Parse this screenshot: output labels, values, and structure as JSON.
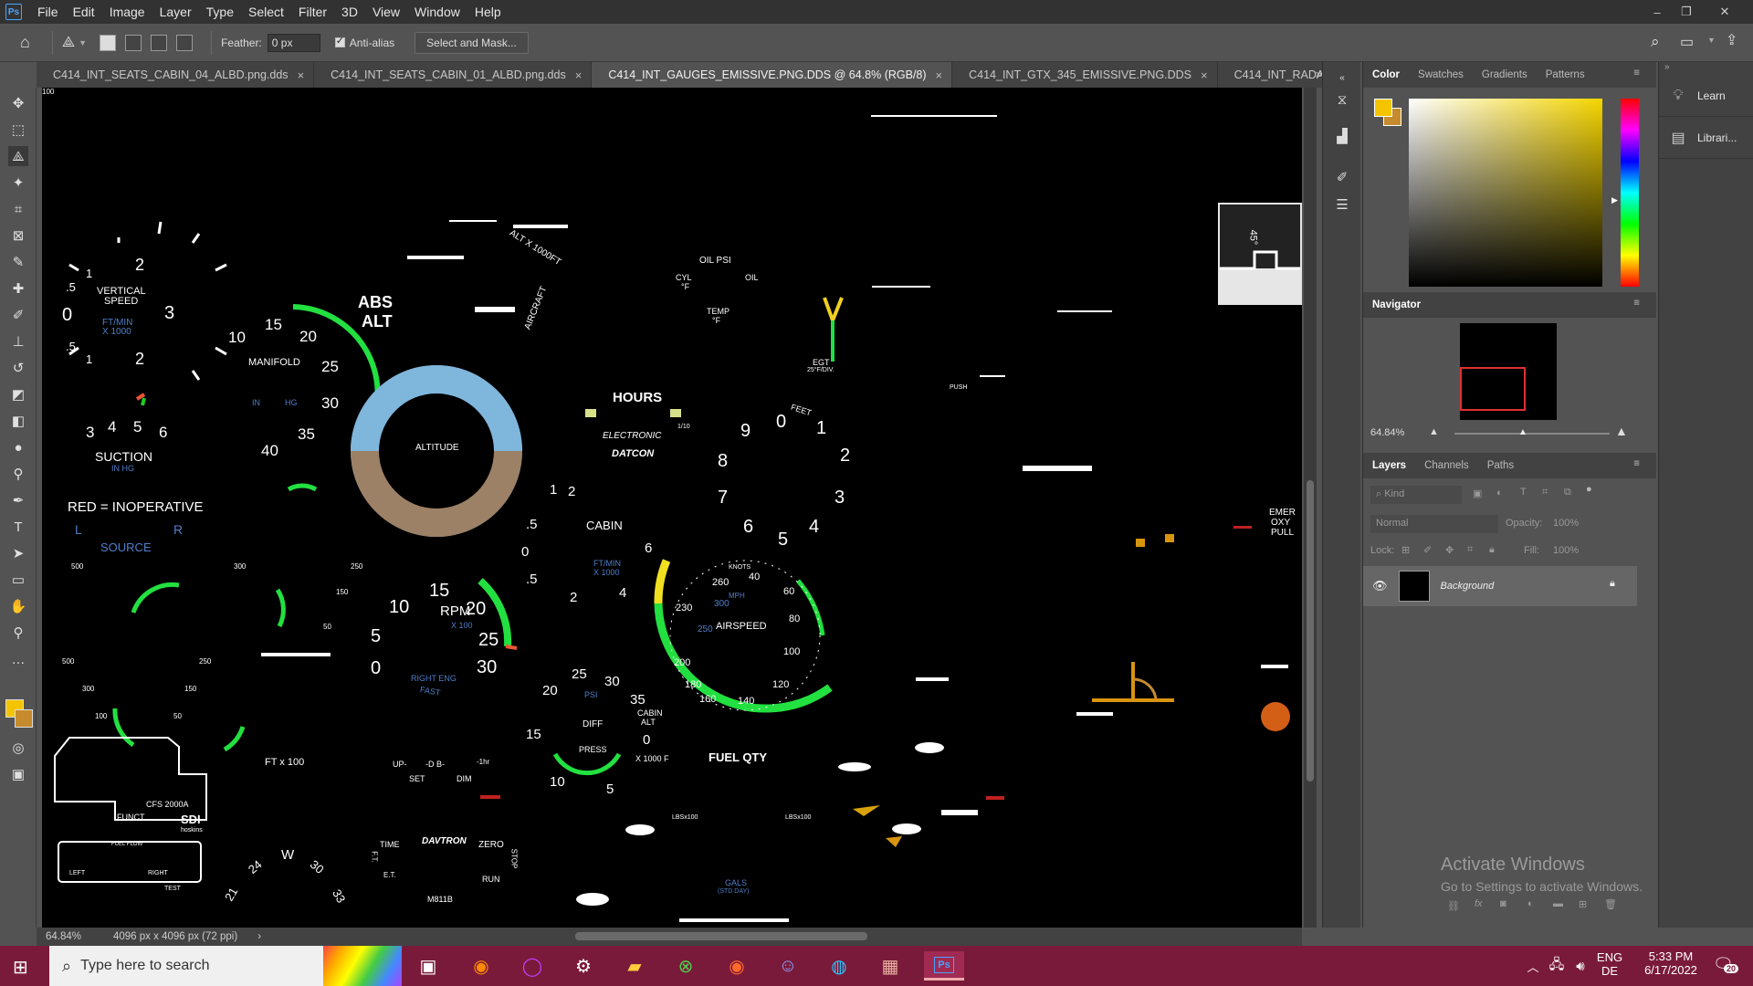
{
  "menubar": {
    "logo": "Ps",
    "items": [
      "File",
      "Edit",
      "Image",
      "Layer",
      "Type",
      "Select",
      "Filter",
      "3D",
      "View",
      "Window",
      "Help"
    ]
  },
  "options": {
    "feather_label": "Feather:",
    "feather_value": "0 px",
    "antialias_label": "Anti-alias",
    "select_mask_label": "Select and Mask..."
  },
  "tabs": [
    {
      "label": "C414_INT_SEATS_CABIN_04_ALBD.png.dds",
      "active": false
    },
    {
      "label": "C414_INT_SEATS_CABIN_01_ALBD.png.dds",
      "active": false
    },
    {
      "label": "C414_INT_GAUGES_EMISSIVE.PNG.DDS @ 64.8% (RGB/8)",
      "active": true
    },
    {
      "label": "C414_INT_GTX_345_EMISSIVE.PNG.DDS",
      "active": false
    },
    {
      "label": "C414_INT_RADAR_EMI",
      "active": false
    }
  ],
  "status": {
    "zoom": "64.84%",
    "doc_info": "4096 px x 4096 px (72 ppi)"
  },
  "color_panel": {
    "tabs": [
      "Color",
      "Swatches",
      "Gradients",
      "Patterns"
    ],
    "foreground": "#f5c400",
    "background": "#c58b2c"
  },
  "navigator": {
    "title": "Navigator",
    "zoom": "64.84%"
  },
  "layers_panel": {
    "tabs": [
      "Layers",
      "Channels",
      "Paths"
    ],
    "kind_placeholder": "Kind",
    "blend_mode": "Normal",
    "opacity_label": "Opacity:",
    "opacity_value": "100%",
    "lock_label": "Lock:",
    "fill_label": "Fill:",
    "fill_value": "100%",
    "layer_name": "Background"
  },
  "learn_panel": {
    "items": [
      "Learn",
      "Librari..."
    ]
  },
  "canvas_text": {
    "vs_vertical": "VERTICAL",
    "vs_speed": "SPEED",
    "vs_ftmin": "FT/MIN",
    "vs_x1000": "X 1000",
    "vs_2a": "2",
    "vs_1a": "1",
    "vs_5a": ".5",
    "vs_0": "0",
    "vs_3": "3",
    "vs_5b": ".5",
    "vs_1b": "1",
    "vs_2b": "2",
    "suction": "SUCTION",
    "suction_unit": "IN HG",
    "suction_3": "3",
    "suction_4": "4",
    "suction_5": "5",
    "suction_6": "6",
    "red_inop": "RED = INOPERATIVE",
    "source_l": "L",
    "source_r": "R",
    "source": "SOURCE",
    "manifold": "MANIFOLD",
    "manifold_in": "IN",
    "manifold_hg": "HG",
    "mf_10": "10",
    "mf_15": "15",
    "mf_20": "20",
    "mf_25": "25",
    "mf_30": "30",
    "mf_35": "35",
    "mf_40": "40",
    "abs": "ABS",
    "alt": "ALT",
    "aircraft": "AIRCRAFT",
    "alt_x1000": "ALT X 1000FT",
    "oil_psi": "OIL  PSI",
    "cyl": "CYL",
    "cyl_f": "°F",
    "oil": "OIL",
    "temp": "TEMP",
    "temp_f": "°F",
    "egt": "EGT",
    "egt_div": "25°F/DIV.",
    "hours": "HOURS",
    "electronic": "ELECTRONIC",
    "tenths": "1/10",
    "datcon": "DATCON",
    "altitude": "ALTITUDE",
    "feet": "FEET",
    "alt_9": "9",
    "alt_0": "0",
    "alt_1": "1",
    "alt_2": "2",
    "alt_3": "3",
    "alt_4": "4",
    "alt_5": "5",
    "alt_6": "6",
    "alt_7": "7",
    "alt_8": "8",
    "cabin": "CABIN",
    "cabin_ftmin": "FT/MIN",
    "cabin_x1000": "X 1000",
    "cab_5a": ".5",
    "cab_0": "0",
    "cab_5b": ".5",
    "cab_1": "1",
    "cab_2a": "2",
    "cab_2b": "2",
    "cab_4": "4",
    "cab_6": "6",
    "push": "PUSH",
    "emer": "EMER",
    "oxy": "OXY",
    "pull": "PULL",
    "deg45": "45°",
    "knots": "KNOTS",
    "mph": "MPH",
    "airspeed": "AIRSPEED",
    "as_260": "260",
    "as_40": "40",
    "as_60": "60",
    "as_80": "80",
    "as_100": "100",
    "as_120": "120",
    "as_140": "140",
    "as_160": "160",
    "as_180": "180",
    "as_200": "200",
    "as_230": "230",
    "as_250": "250",
    "as_300": "300",
    "rpm": "RPM",
    "rpm_x100": "X 100",
    "rpm_5": "5",
    "rpm_10": "10",
    "rpm_15": "15",
    "rpm_20": "20",
    "rpm_25": "25",
    "rpm_30": "30",
    "rpm_0": "0",
    "right_eng": "RIGHT  ENG",
    "fast": "FAST",
    "psi": "PSI",
    "diff": "DIFF",
    "press": "PRESS",
    "cabin_alt": "CABIN",
    "cabin_alt2": "ALT",
    "ca_20": "20",
    "ca_25": "25",
    "ca_30": "30",
    "ca_35": "35",
    "ca_15": "15",
    "ca_10": "10",
    "ca_5": "5",
    "ca_0": "0",
    "ca_x1000": "X 1000 F",
    "fuel_qty": "FUEL QTY",
    "lbs_x100": "LBSx100",
    "gals": "GALS",
    "std_day": "(STD DAY)",
    "ft_x100": "FT x 100",
    "cfs": "CFS 2000A",
    "funct": "FUNCT.",
    "sdi": "SDI",
    "hoskins": "hoskins",
    "fuel_flow": "FUEL FLOW",
    "left": "LEFT",
    "right": "RIGHT",
    "test": "TEST",
    "up": "UP-",
    "db": "-D B-",
    "hr": "-1hr",
    "set": "SET",
    "dim": "DIM",
    "time": "TIME",
    "davtron": "DAVTRON",
    "zero": "ZERO",
    "stop": "STOP",
    "run": "RUN",
    "et": "E.T.",
    "ft": "F.T.",
    "m811b": "M811B",
    "b500": "500",
    "b300": "300",
    "b100": "100",
    "b250": "250",
    "b150": "150",
    "b50": "50",
    "w": "W",
    "h24": "24",
    "h21": "21",
    "h30": "30",
    "h33": "33"
  },
  "taskbar": {
    "search_placeholder": "Type here to search",
    "lang": "ENG",
    "region": "DE",
    "time": "5:33 PM",
    "date": "6/17/2022",
    "notif": "20"
  },
  "watermark": {
    "line1": "Activate Windows",
    "line2": "Go to Settings to activate Windows."
  }
}
